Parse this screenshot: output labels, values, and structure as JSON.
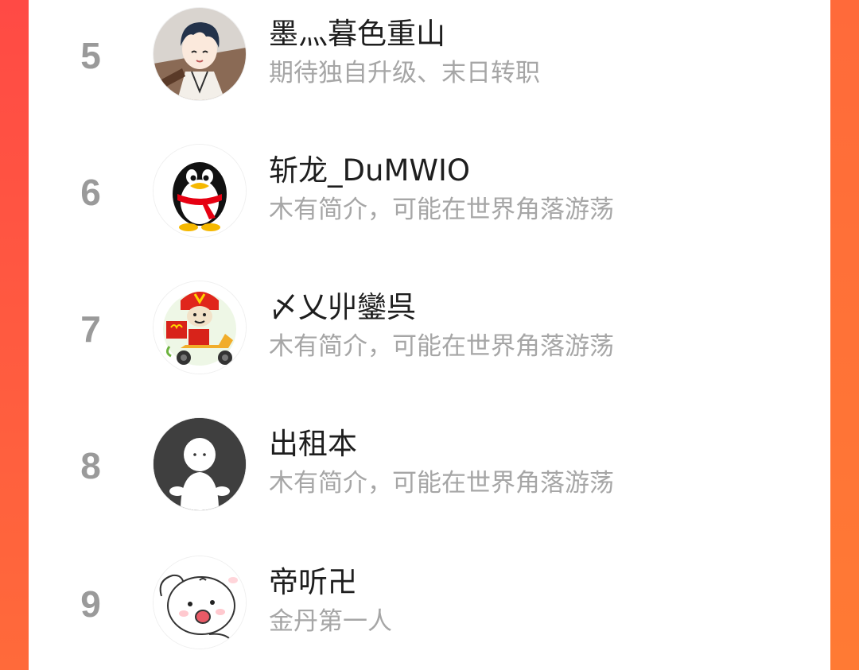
{
  "accent_colors": {
    "background_gradient_top": "#ff4a45",
    "background_gradient_bottom": "#ff6a3a",
    "rank_text": "#9a9a9a",
    "name_text": "#1e1e1e",
    "bio_text": "#a6a6a6"
  },
  "ranking_list": {
    "entries": [
      {
        "rank": "5",
        "name": "墨灬暮色重山",
        "bio": "期待独自升级、末日转职",
        "avatar_icon": "anime-boy-avatar-icon"
      },
      {
        "rank": "6",
        "name": "斩龙_DuMWIO",
        "bio": "木有简介，可能在世界角落游荡",
        "avatar_icon": "qq-penguin-avatar-icon"
      },
      {
        "rank": "7",
        "name": "〆乂丱鑾呉",
        "bio": "木有简介，可能在世界角落游荡",
        "avatar_icon": "delivery-rider-avatar-icon"
      },
      {
        "rank": "8",
        "name": "出租本",
        "bio": "木有简介，可能在世界角落游荡",
        "avatar_icon": "default-person-avatar-icon"
      },
      {
        "rank": "9",
        "name": "帝听卍",
        "bio": "金丹第一人",
        "avatar_icon": "cartoon-bunny-avatar-icon"
      }
    ]
  }
}
